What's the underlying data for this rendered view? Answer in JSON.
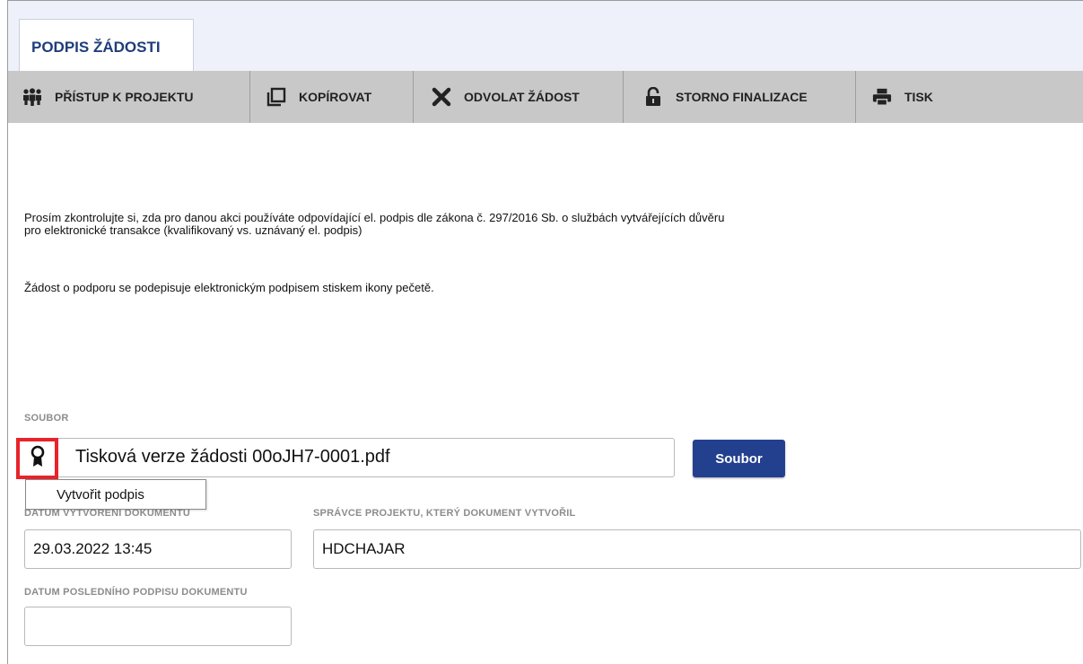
{
  "tab": {
    "title": "PODPIS ŽÁDOSTI"
  },
  "toolbar": {
    "items": [
      {
        "label": "PŘÍSTUP K PROJEKTU",
        "icon": "people-icon"
      },
      {
        "label": "KOPÍROVAT",
        "icon": "copy-icon"
      },
      {
        "label": "ODVOLAT ŽÁDOST",
        "icon": "close-icon"
      },
      {
        "label": "STORNO FINALIZACE",
        "icon": "unlock-icon"
      },
      {
        "label": "TISK",
        "icon": "print-icon"
      }
    ]
  },
  "notice": {
    "line1": "Prosím zkontrolujte si, zda pro danou akci používáte odpovídající el. podpis dle zákona č. 297/2016 Sb. o službách vytvářejících důvěru",
    "line2": "pro elektronické transakce (kvalifikovaný vs. uznávaný el. podpis)",
    "line3": "Žádost o podporu se podepisuje elektronickým podpisem stiskem ikony pečetě."
  },
  "file": {
    "label": "SOUBOR",
    "name": "Tisková verze žádosti 00oJH7-0001.pdf",
    "button": "Soubor",
    "seal_icon": "seal-icon",
    "tooltip": "Vytvořit podpis"
  },
  "fields": {
    "created_label": "DATUM VYTVOŘENÍ DOKUMENTU",
    "created_value": "29.03.2022 13:45",
    "manager_label": "SPRÁVCE PROJEKTU, KTERÝ DOKUMENT VYTVOŘIL",
    "manager_value": "HDCHAJAR",
    "last_sign_label": "DATUM POSLEDNÍHO PODPISU DOKUMENTU",
    "last_sign_value": ""
  },
  "colors": {
    "tab_title": "#1f3d7a",
    "toolbar_bg": "#c8c8c8",
    "button_bg": "#23408e",
    "highlight": "#e8232a"
  }
}
